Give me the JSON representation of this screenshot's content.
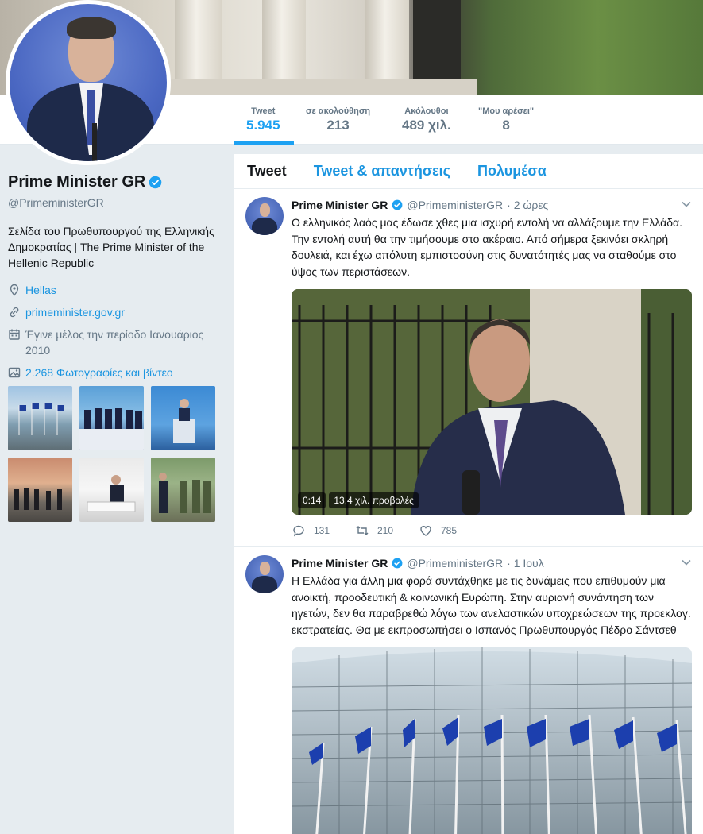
{
  "colors": {
    "accent": "#1da1f2",
    "link": "#1b95e0",
    "verified": "#1da1f2",
    "muted": "#657786"
  },
  "nav": {
    "stats": [
      {
        "label": "Tweet",
        "value": "5.945"
      },
      {
        "label": "σε ακολούθηση",
        "value": "213"
      },
      {
        "label": "Ακόλουθοι",
        "value": "489 χιλ."
      },
      {
        "label": "\"Μου αρέσει\"",
        "value": "8"
      }
    ]
  },
  "profile": {
    "name": "Prime Minister GR",
    "handle": "@PrimeministerGR",
    "bio": "Σελίδα του Πρωθυπουργού της Ελληνικής Δημοκρατίας | The Prime Minister of the Hellenic Republic",
    "location": "Hellas",
    "website": "primeminister.gov.gr",
    "joined": "Έγινε μέλος την περίοδο Ιανουάριος 2010",
    "photos": "2.268 Φωτογραφίες και βίντεο"
  },
  "timeline": {
    "tabs": [
      "Tweet",
      "Tweet & απαντήσεις",
      "Πολυμέσα"
    ],
    "tweets": [
      {
        "name": "Prime Minister GR",
        "handle": "@PrimeministerGR",
        "time": "· 2 ώρες",
        "text": "Ο ελληνικός λαός μας έδωσε χθες μια ισχυρή εντολή να αλλάξουμε την Ελλάδα. Την εντολή αυτή θα την τιμήσουμε στο ακέραιο. Από σήμερα ξεκινάει σκληρή δουλειά, και έχω απόλυτη εμπιστοσύνη στις δυνατότητές μας να σταθούμε στο ύψος των περιστάσεων.",
        "video_duration": "0:14",
        "video_views": "13,4 χιλ. προβολές",
        "replies": "131",
        "retweets": "210",
        "likes": "785"
      },
      {
        "name": "Prime Minister GR",
        "handle": "@PrimeministerGR",
        "time": "· 1 Ιουλ",
        "text": "Η Ελλάδα για άλλη μια φορά συντάχθηκε με τις δυνάμεις που επιθυμούν μια ανοικτή, προοδευτική & κοινωνική Ευρώπη. Στην αυριανή συνάντηση των ηγετών, δεν θα παραβρεθώ λόγω των ανελαστικών υποχρεώσεων της προεκλογ. εκστρατείας. Θα με εκπροσωπήσει ο Ισπανός Πρωθυπουργός Πέδρο Σάντσεθ"
      }
    ]
  }
}
